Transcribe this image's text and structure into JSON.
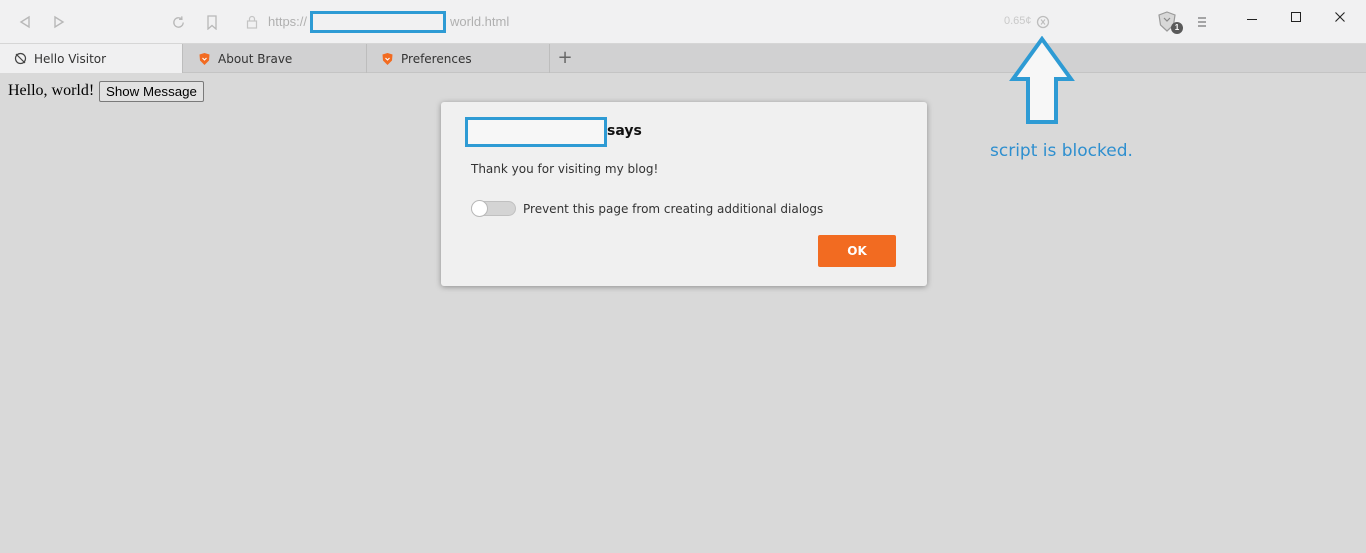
{
  "window": {
    "url_prefix": "https://",
    "url_suffix": "world.html",
    "bat_amount": "0.65¢",
    "shield_count": "1"
  },
  "tabs": [
    {
      "label": "Hello Visitor",
      "icon": "crossed-circle-icon",
      "active": true
    },
    {
      "label": "About Brave",
      "icon": "brave-lion-icon",
      "active": false
    },
    {
      "label": "Preferences",
      "icon": "brave-lion-icon",
      "active": false
    }
  ],
  "new_tab_label": "+",
  "page": {
    "text": "Hello, world!",
    "button_label": "Show Message"
  },
  "dialog": {
    "says": "says",
    "message": "Thank you for visiting my blog!",
    "toggle_label": "Prevent this page from creating additional dialogs",
    "ok_label": "OK"
  },
  "annotation": {
    "text": "script is blocked."
  },
  "colors": {
    "accent_blue": "#2e9bd4",
    "ok_orange": "#f26b21"
  }
}
